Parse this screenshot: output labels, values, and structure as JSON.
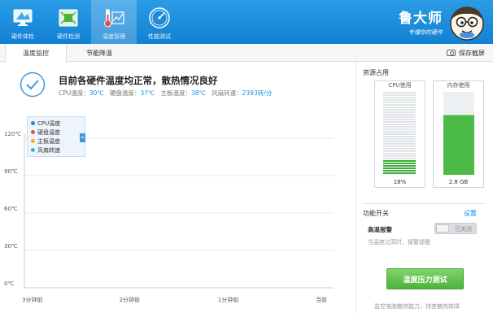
{
  "nav": [
    {
      "label": "硬件体检",
      "icon": "monitor-icon",
      "active": false
    },
    {
      "label": "硬件检测",
      "icon": "circuit-board-icon",
      "active": false
    },
    {
      "label": "温度管理",
      "icon": "thermometer-chart-icon",
      "active": true
    },
    {
      "label": "性能测试",
      "icon": "speedometer-icon",
      "active": false
    }
  ],
  "brand": {
    "name": "鲁大师",
    "slogan": "专懂你的硬件"
  },
  "subtabs": {
    "temp_monitor": "温度监控",
    "energy_saving": "节能降温",
    "save_screenshot": "保存截屏"
  },
  "status": {
    "title": "目前各硬件温度均正常，散热情况良好",
    "cpu_label": "CPU温度：",
    "cpu_value": "30℃",
    "disk_label": "硬盘温度：",
    "disk_value": "37℃",
    "board_label": "主板温度：",
    "board_value": "38℃",
    "fan_label": "风扇转速：",
    "fan_value": "2393转/分"
  },
  "legend": {
    "items": [
      {
        "label": "CPU温度",
        "color": "#2f7fd8"
      },
      {
        "label": "硬盘温度",
        "color": "#e84b4b"
      },
      {
        "label": "主板温度",
        "color": "#f3b300"
      },
      {
        "label": "风扇转速",
        "color": "#37b3e6"
      }
    ],
    "toggle": "»"
  },
  "chart_data": {
    "type": "line",
    "title": "",
    "xlabel": "",
    "ylabel": "",
    "x_ticks": [
      "3分钟前",
      "2分钟前",
      "1分钟前",
      "当前"
    ],
    "y_ticks": [
      "0℃",
      "30℃",
      "60℃",
      "90℃",
      "120℃"
    ],
    "ylim": [
      0,
      120
    ],
    "grid": true,
    "series": []
  },
  "resources": {
    "title": "资源占用",
    "cpu": {
      "label": "CPU使用",
      "value": "18%",
      "usage": 0.18
    },
    "memory": {
      "label": "内存使用",
      "value": "2.8 GB",
      "usage": 0.72
    }
  },
  "functions": {
    "title": "功能开关",
    "settings": "设置",
    "alarm_label": "高温报警",
    "alarm_state": "已关闭",
    "alarm_desc": "当温度过高时，报警提醒"
  },
  "stress": {
    "button": "温度压力测试",
    "desc": "监控电脑散热能力，排查散热故障"
  },
  "colors": {
    "header": "#1a8ee0",
    "accent": "#1a8ee0",
    "green": "#4db33a"
  }
}
